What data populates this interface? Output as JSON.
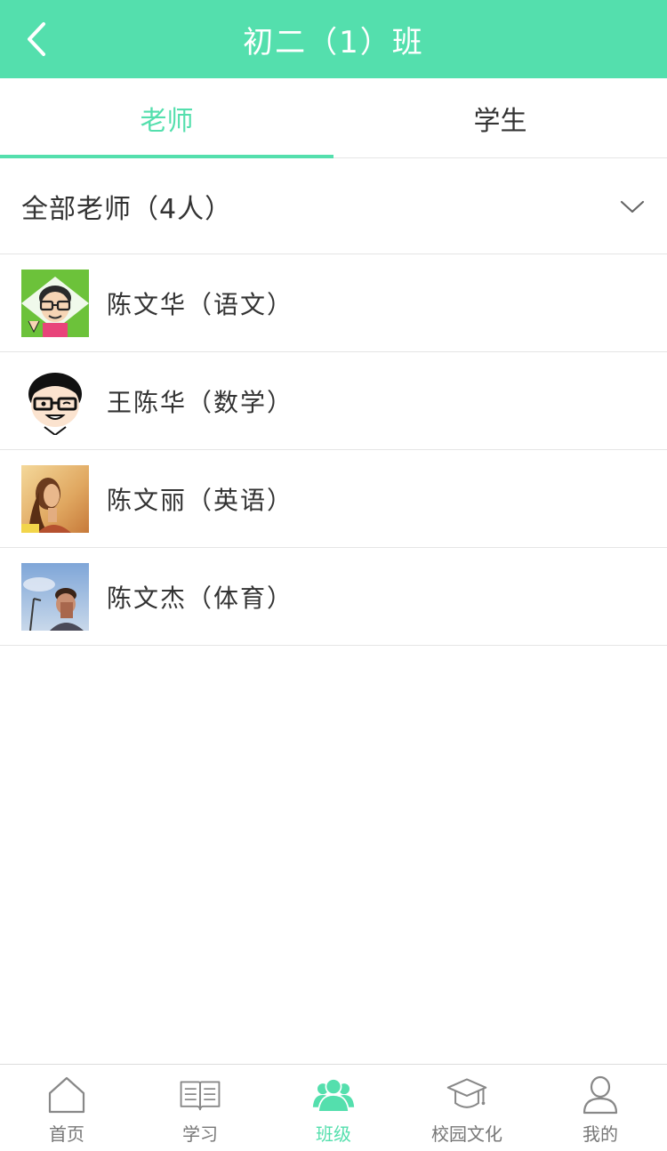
{
  "header": {
    "title": "初二（1）班",
    "back_icon": "chevron-left-icon"
  },
  "tabs": [
    {
      "label": "老师",
      "active": true
    },
    {
      "label": "学生",
      "active": false
    }
  ],
  "filter": {
    "label": "全部老师（4人）",
    "icon": "chevron-down-icon"
  },
  "teachers": [
    {
      "name": "陈文华（语文）",
      "avatar": "cartoon-glasses-avatar"
    },
    {
      "name": "王陈华（数学）",
      "avatar": "cartoon-face-avatar"
    },
    {
      "name": "陈文丽（英语）",
      "avatar": "photo-woman-avatar"
    },
    {
      "name": "陈文杰（体育）",
      "avatar": "photo-man-sky-avatar"
    }
  ],
  "bottom_nav": [
    {
      "label": "首页",
      "icon": "home-icon",
      "active": false
    },
    {
      "label": "学习",
      "icon": "book-icon",
      "active": false
    },
    {
      "label": "班级",
      "icon": "group-icon",
      "active": true
    },
    {
      "label": "校园文化",
      "icon": "graduation-cap-icon",
      "active": false
    },
    {
      "label": "我的",
      "icon": "person-icon",
      "active": false
    }
  ],
  "colors": {
    "accent": "#54dfad",
    "text": "#333333",
    "divider": "#e5e5e5"
  }
}
